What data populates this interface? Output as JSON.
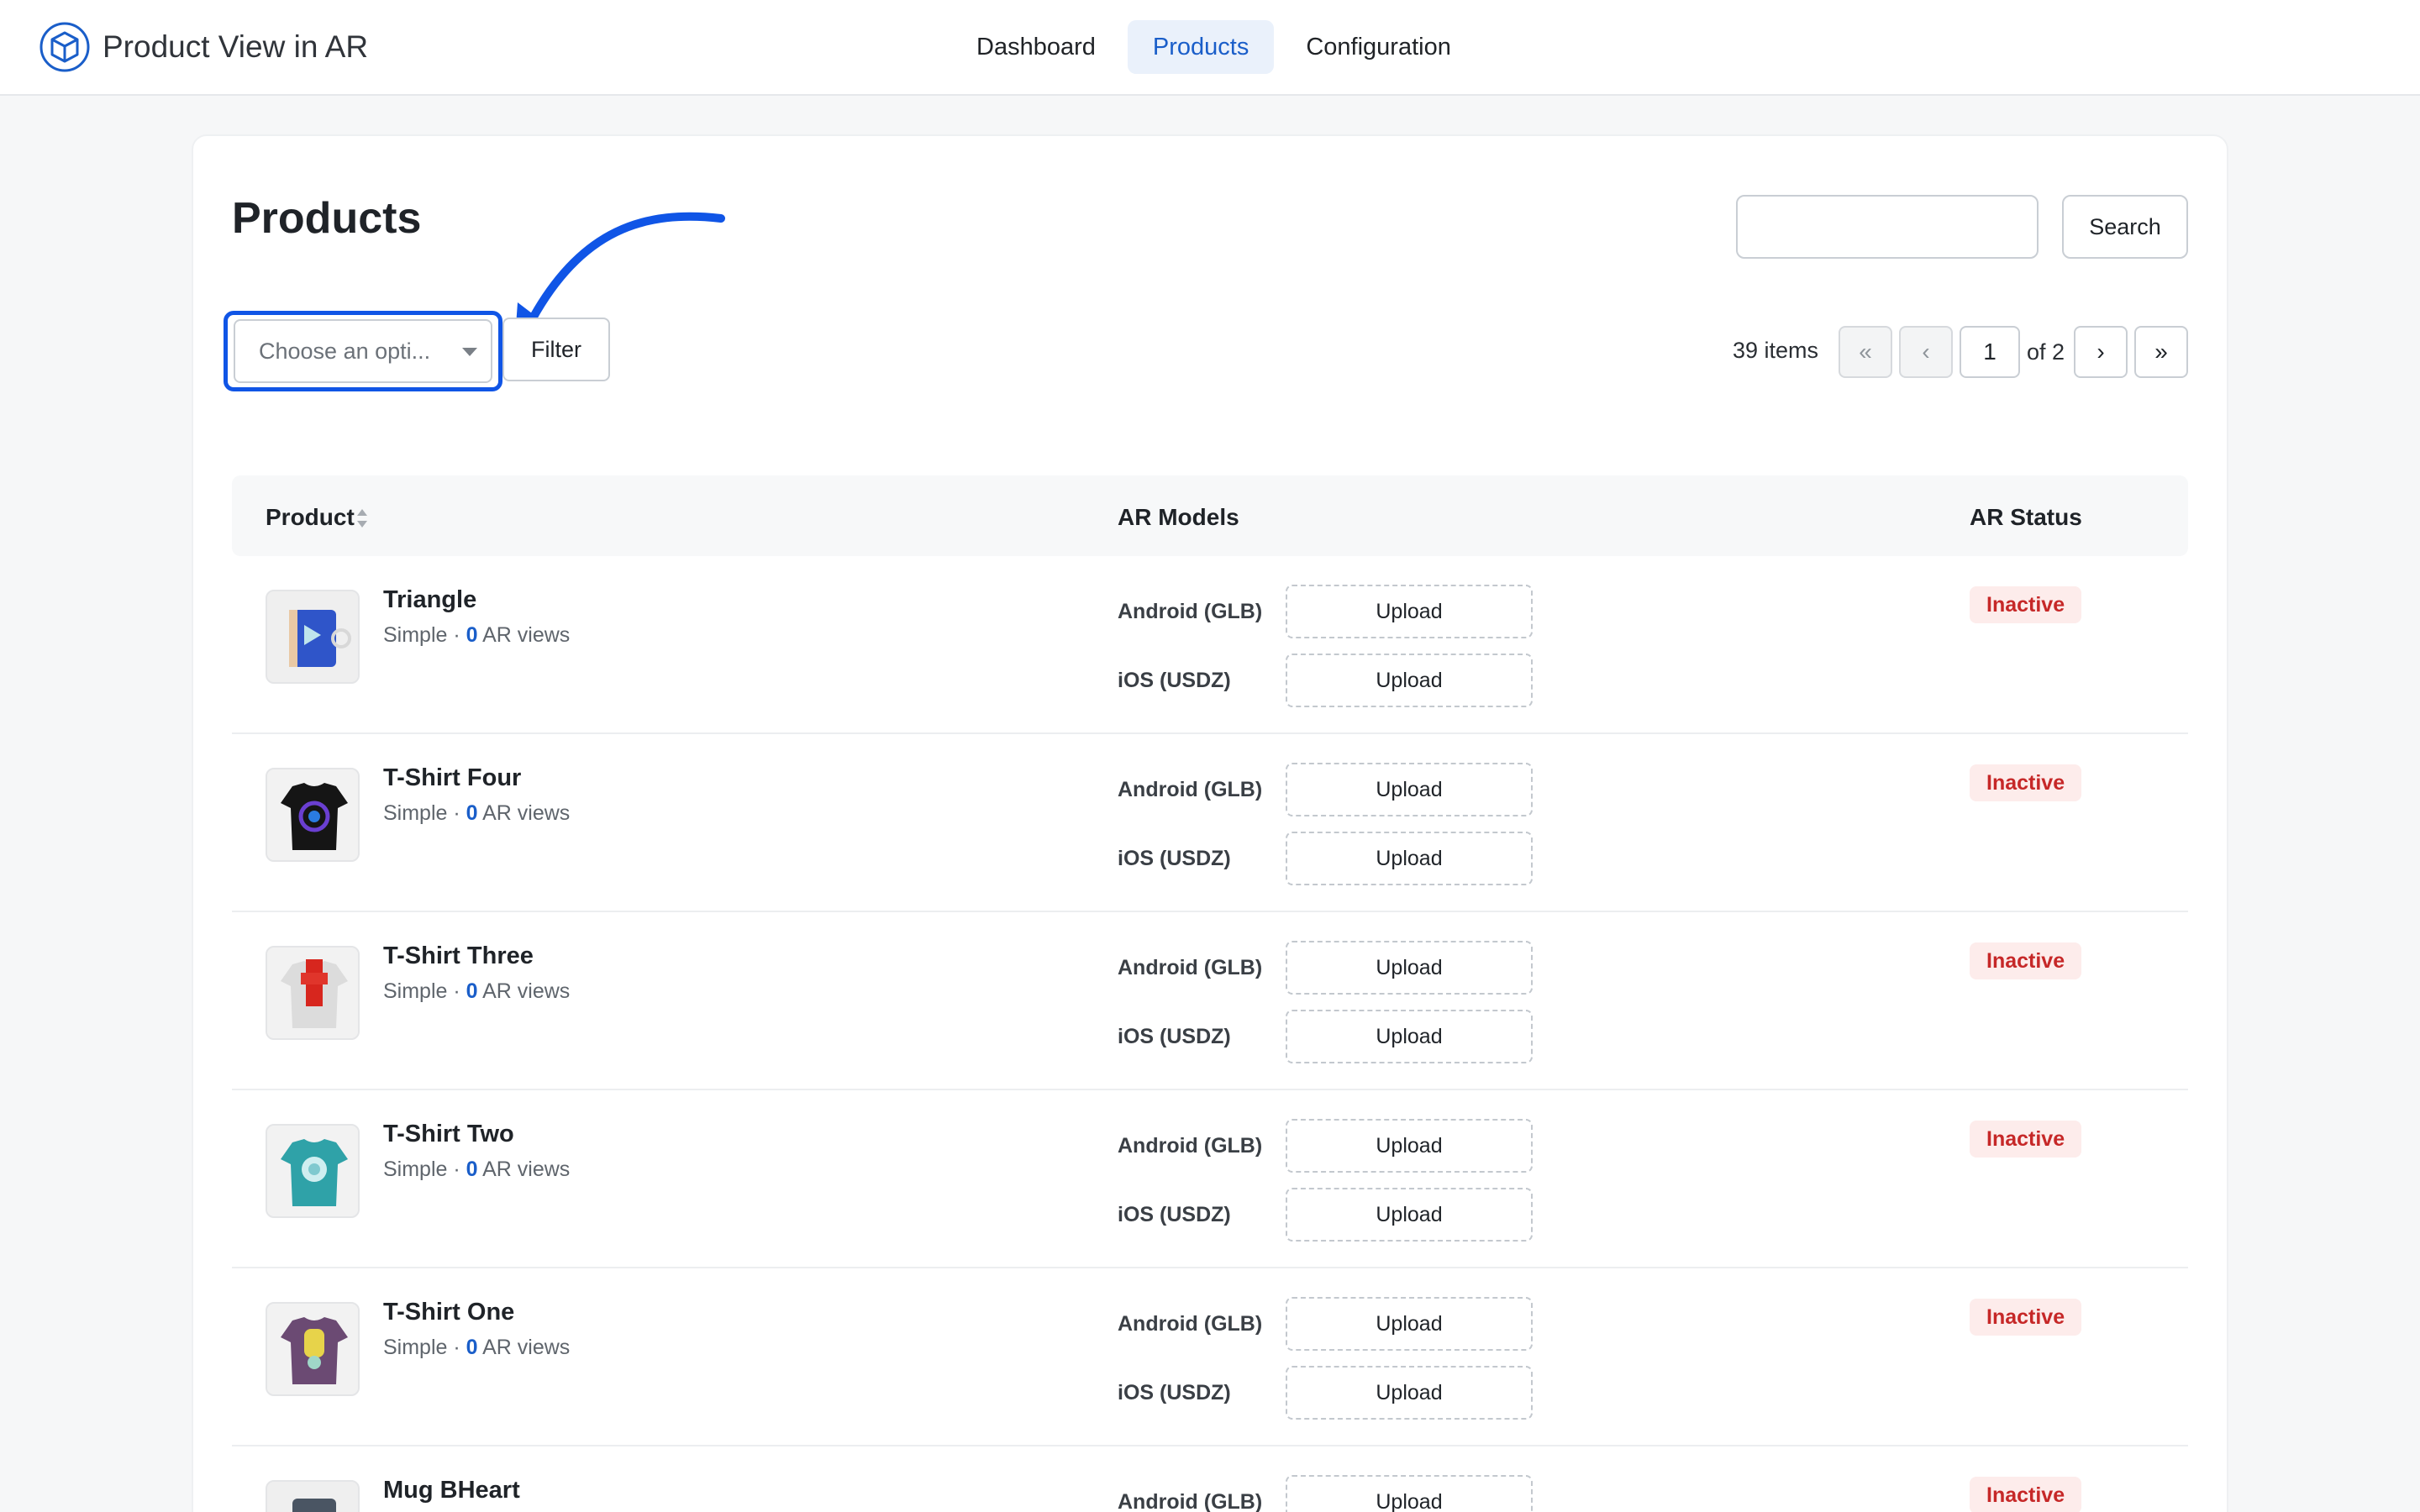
{
  "app": {
    "title": "Product View in AR"
  },
  "nav": {
    "tabs": [
      {
        "label": "Dashboard"
      },
      {
        "label": "Products"
      },
      {
        "label": "Configuration"
      }
    ]
  },
  "page": {
    "title": "Products"
  },
  "search": {
    "placeholder": "",
    "button_label": "Search"
  },
  "filter": {
    "select_placeholder": "Choose an opti...",
    "button_label": "Filter"
  },
  "pagination": {
    "items_label": "39 items",
    "first": "«",
    "prev": "‹",
    "current": "1",
    "of_label": "of 2",
    "next": "›",
    "last": "»"
  },
  "table": {
    "headers": {
      "product": "Product",
      "ar_models": "AR Models",
      "ar_status": "AR Status"
    },
    "android_label": "Android (GLB)",
    "ios_label": "iOS (USDZ)",
    "upload_label": "Upload",
    "rows": [
      {
        "name": "Triangle",
        "type": "Simple",
        "views": "0",
        "views_label": "AR views",
        "status": "Inactive"
      },
      {
        "name": "T-Shirt Four",
        "type": "Simple",
        "views": "0",
        "views_label": "AR views",
        "status": "Inactive"
      },
      {
        "name": "T-Shirt Three",
        "type": "Simple",
        "views": "0",
        "views_label": "AR views",
        "status": "Inactive"
      },
      {
        "name": "T-Shirt Two",
        "type": "Simple",
        "views": "0",
        "views_label": "AR views",
        "status": "Inactive"
      },
      {
        "name": "T-Shirt One",
        "type": "Simple",
        "views": "0",
        "views_label": "AR views",
        "status": "Inactive"
      },
      {
        "name": "Mug BHeart",
        "type": "",
        "views": "",
        "views_label": "",
        "status": "Inactive"
      }
    ]
  },
  "colors": {
    "accent": "#1a5ec9",
    "highlight": "#1055e6",
    "inactive": "#c62828"
  }
}
